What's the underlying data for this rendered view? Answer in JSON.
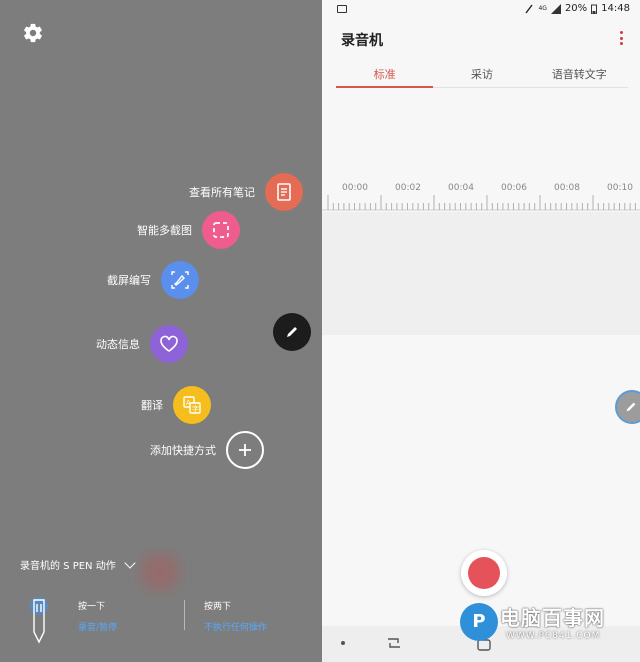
{
  "left": {
    "menu": [
      {
        "label": "查看所有笔记",
        "icon": "notes-icon",
        "color": "#e56b55"
      },
      {
        "label": "智能多截图",
        "icon": "smart-select-icon",
        "color": "#ef5d8f"
      },
      {
        "label": "截屏编写",
        "icon": "screen-write-icon",
        "color": "#5b8fee"
      },
      {
        "label": "动态信息",
        "icon": "live-message-icon",
        "color": "#8f63d8"
      },
      {
        "label": "翻译",
        "icon": "translate-icon",
        "color": "#f6be1d"
      }
    ],
    "add_shortcut": "添加快捷方式",
    "spen": {
      "title": "录音机的 S PEN 动作",
      "press_once": {
        "title": "按一下",
        "value": "录音/暂停"
      },
      "press_twice": {
        "title": "按两下",
        "value": "不执行任何操作"
      }
    }
  },
  "right": {
    "status": {
      "signal": "4G",
      "battery": "20%",
      "time": "14:48"
    },
    "title": "录音机",
    "tabs": [
      "标准",
      "采访",
      "语音转文字"
    ],
    "active_tab": 0,
    "timeline": [
      "00:00",
      "00:02",
      "00:04",
      "00:06",
      "00:08",
      "00:10"
    ],
    "watermark": {
      "logo": "P",
      "text": "电脑百事网",
      "sub": "WWW.PC841.COM"
    }
  },
  "colors": {
    "accent": "#d5574f",
    "record": "#e5525a"
  }
}
